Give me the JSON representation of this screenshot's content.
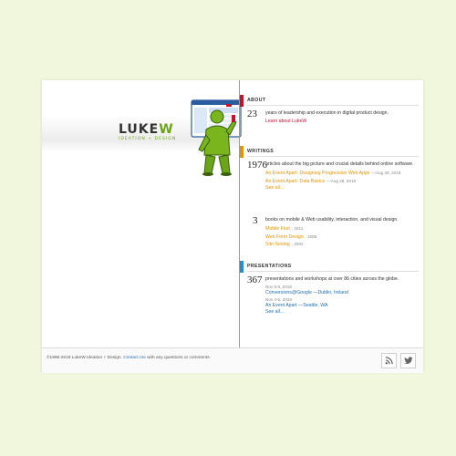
{
  "brand": {
    "wordmark_main": "LUKE",
    "wordmark_accent": "W",
    "tagline": "IDEATION + DESIGN"
  },
  "colors": {
    "background": "#f1f7dc",
    "about": "#c8102e",
    "writings": "#e59400",
    "presentations": "#1f8fd0",
    "logo_green": "#6aa517"
  },
  "about": {
    "title": "ABOUT",
    "number": "23",
    "description": "years of leadership and execution in digital product design.",
    "link": "Learn about LukeW"
  },
  "writings": {
    "title": "WRITINGS",
    "articles": {
      "number": "1976",
      "description": "articles about the big picture and crucial details behind online software.",
      "items": [
        {
          "label": "An Event Apart: Designing Progressive Web Apps",
          "date": "—Aug 28, 2018"
        },
        {
          "label": "An Event Apart: Data Basics",
          "date": "—Aug 28, 2018"
        }
      ],
      "see_all": "See all..."
    },
    "books": {
      "number": "3",
      "description": "books on mobile & Web usability, interaction, and visual design.",
      "items": [
        {
          "label": "Mobile First",
          "year": ", 2011"
        },
        {
          "label": "Web Form Design",
          "year": ", 2008"
        },
        {
          "label": "Site-Seeing",
          "year": ", 2002"
        }
      ]
    }
  },
  "presentations": {
    "title": "PRESENTATIONS",
    "number": "367",
    "description": "presentations and workshops at over 86 cities across the globe.",
    "items": [
      {
        "date": "Nov 5-6, 2018",
        "label": "Conversions@Google —Dublin, Ireland"
      },
      {
        "date": "Nov 4-5, 2019",
        "label": "An Event Apart —Seattle, WA"
      }
    ],
    "see_all": "See all..."
  },
  "footer": {
    "prefix": "©1996-2018 LukeW Ideation + Design.",
    "contact_link": "Contact me",
    "suffix": "with any questions or comments.",
    "rss_icon": "rss-icon",
    "twitter_icon": "twitter-icon"
  }
}
